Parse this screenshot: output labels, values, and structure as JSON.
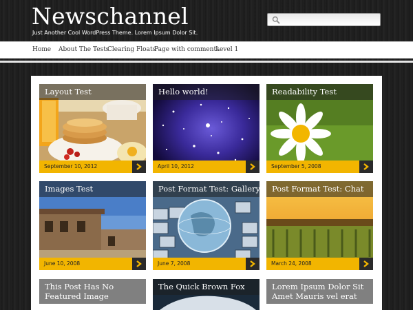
{
  "site": {
    "title": "Newschannel",
    "tagline": "Just Another Cool WordPress Theme. Lorem Ipsum Dolor Sit.",
    "search_placeholder": ""
  },
  "nav": {
    "items": [
      {
        "label": "Home"
      },
      {
        "label": "About The Tests"
      },
      {
        "label": "Clearing Floats"
      },
      {
        "label": "Page with comments"
      },
      {
        "label": "Level 1"
      }
    ]
  },
  "colors": {
    "accent": "#f2b500",
    "background": "#1c1c1c",
    "title_overlay": "#1e1e1e",
    "arrow_box": "#2a2a2a"
  },
  "posts": [
    {
      "title": "Layout Test",
      "date": "September 10, 2012",
      "image": "pancakes-breakfast"
    },
    {
      "title": "Hello world!",
      "date": "April 10, 2012",
      "image": "starry-galaxy"
    },
    {
      "title": "Readability Test",
      "date": "September 5, 2008",
      "image": "daisy-flower"
    },
    {
      "title": "Images Test",
      "date": "June 10, 2008",
      "image": "old-west-buildings"
    },
    {
      "title": "Post Format Test: Gallery",
      "date": "June 7, 2008",
      "image": "globe-on-keyboard"
    },
    {
      "title": "Post Format Test: Chat",
      "date": "March 24, 2008",
      "image": "vineyard-sunset"
    },
    {
      "title": "This Post Has No Featured Image",
      "date": "",
      "image": ""
    },
    {
      "title": "The Quick Brown Fox",
      "date": "",
      "image": "car"
    },
    {
      "title": "Lorem Ipsum Dolor Sit Amet Mauris vel erat",
      "date": "",
      "image": ""
    }
  ],
  "icons": {
    "search": "search-icon",
    "arrow": "chevron-right-icon"
  }
}
